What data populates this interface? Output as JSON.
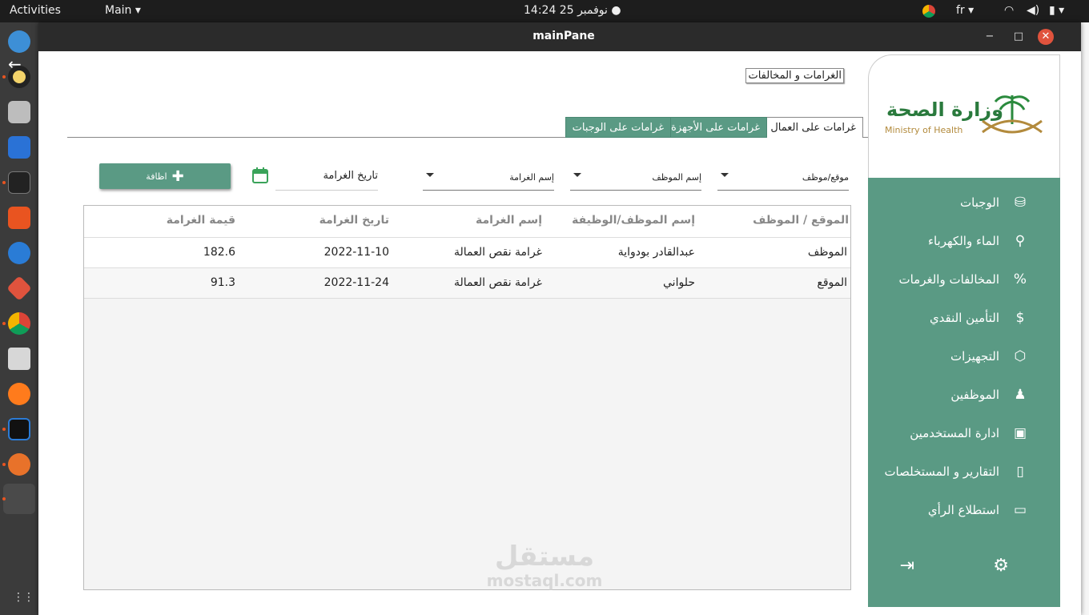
{
  "topbar": {
    "activities": "Activities",
    "app_menu": "Main ▾",
    "datetime": "14:24  25 نوفمبر",
    "lang": "fr ▾"
  },
  "window": {
    "title": "mainPane",
    "minimize": "−",
    "maximize": "□",
    "close": "✕"
  },
  "logo": {
    "arabic": "وزارة الصحة",
    "english": "Ministry of Health"
  },
  "page": {
    "title": "الغرامات و المخالفات"
  },
  "tabs": [
    {
      "label": "غرامات على العمال",
      "active": true
    },
    {
      "label": "غرامات على الأجهزة",
      "active": false
    },
    {
      "label": "غرامات على الوجبات",
      "active": false
    }
  ],
  "filters": {
    "site_employee": "موقع/موظف",
    "employee_name": "إسم الموظف",
    "fine_name": "إسم الغرامة",
    "fine_date": "تاريخ الغرامة",
    "add_label": "اظافة"
  },
  "table": {
    "headers": [
      "الموقع / الموظف",
      "إسم الموظف/الوظيفة",
      "إسم الغرامة",
      "تاريخ الغرامة",
      "قيمة الغرامة"
    ],
    "rows": [
      [
        "الموظف",
        "عبدالقادر بودواية",
        "غرامة نقص العمالة",
        "2022-11-10",
        "182.6"
      ],
      [
        "الموقع",
        "حلواني",
        "غرامة نقص العمالة",
        "2022-11-24",
        "91.3"
      ]
    ]
  },
  "sidebar": {
    "items": [
      {
        "label": "الوجبات",
        "icon": "basket-icon"
      },
      {
        "label": "الماء والكهرباء",
        "icon": "faucet-icon"
      },
      {
        "label": "المخالفات والغرمات",
        "icon": "percent-icon"
      },
      {
        "label": "التأمين النقدي",
        "icon": "dollar-icon"
      },
      {
        "label": "التجهيزات",
        "icon": "box-icon"
      },
      {
        "label": "الموظفين",
        "icon": "user-tie-icon"
      },
      {
        "label": "ادارة المستخدمين",
        "icon": "id-card-icon"
      },
      {
        "label": "التقارير و المستخلصات",
        "icon": "file-icon"
      },
      {
        "label": "استطلاع الرأي",
        "icon": "comment-icon"
      }
    ]
  },
  "watermark": {
    "arabic": "مستقل",
    "latin": "mostaql.com"
  },
  "colors": {
    "accent": "#5a9a84",
    "topbar": "#1d1d1d",
    "dock": "#3b3b3b"
  }
}
